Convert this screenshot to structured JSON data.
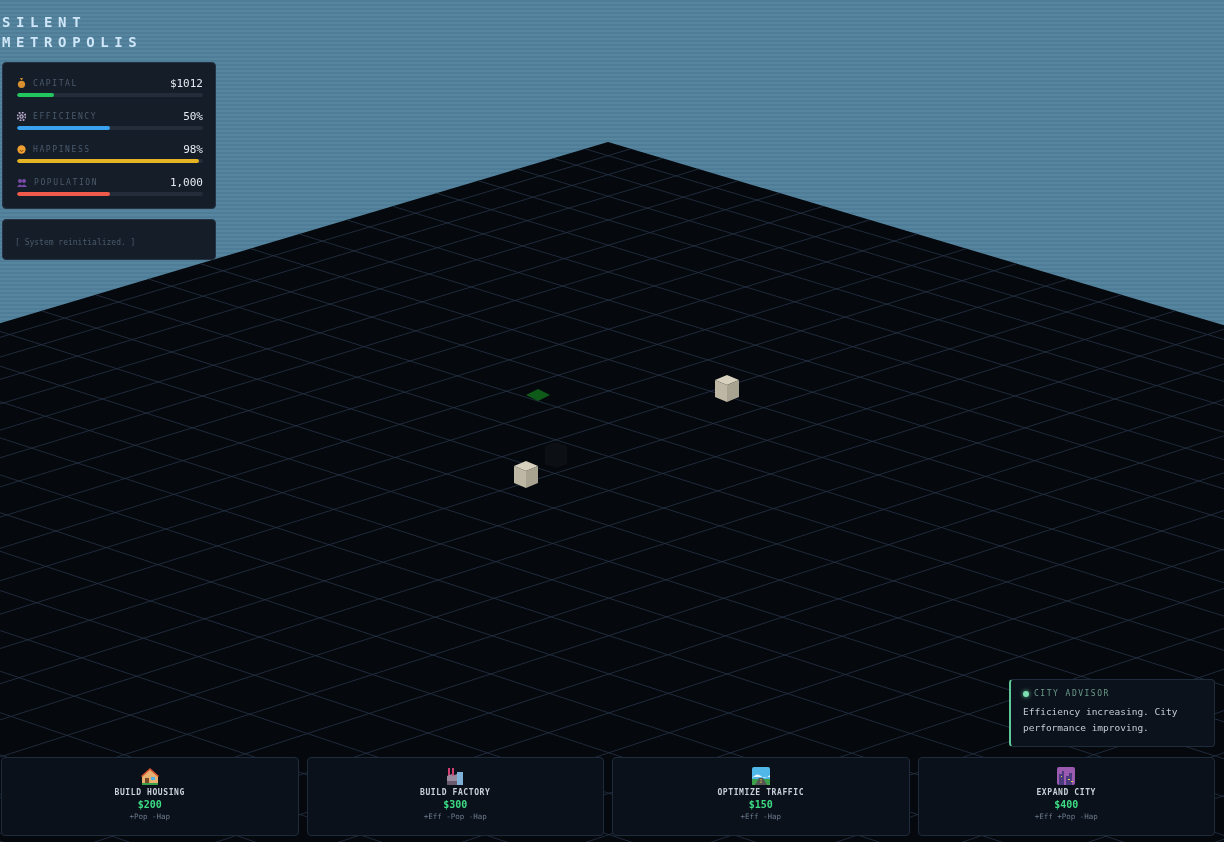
{
  "title": [
    "SILENT",
    "METROPOLIS"
  ],
  "stats": [
    {
      "kind": "coin",
      "label": "CAPITAL",
      "value": "$1012",
      "level": 0.2,
      "color": "#22c55e"
    },
    {
      "kind": "gear",
      "label": "EFFICIENCY",
      "value": "50%",
      "level": 0.5,
      "color": "#3aa0f0"
    },
    {
      "kind": "smile",
      "label": "HAPPINESS",
      "value": "98%",
      "level": 0.98,
      "color": "#e6b325"
    },
    {
      "kind": "people",
      "label": "POPULATION",
      "value": "1,000",
      "level": 0.5,
      "color": "#ef5a4a"
    }
  ],
  "log": "[ System reinitialized. ]",
  "advisor": {
    "title": "CITY ADVISOR",
    "message": "Efficiency increasing. City performance improving."
  },
  "actions": [
    {
      "kind": "house",
      "label": "BUILD HOUSING",
      "cost": "$200",
      "effects": "+Pop -Hap"
    },
    {
      "kind": "factory",
      "label": "BUILD FACTORY",
      "cost": "$300",
      "effects": "+Eff -Pop -Hap"
    },
    {
      "kind": "road",
      "label": "OPTIMIZE TRAFFIC",
      "cost": "$150",
      "effects": "+Eff -Hap"
    },
    {
      "kind": "city",
      "label": "EXPAND CITY",
      "cost": "$400",
      "effects": "+Eff +Pop -Hap"
    }
  ]
}
